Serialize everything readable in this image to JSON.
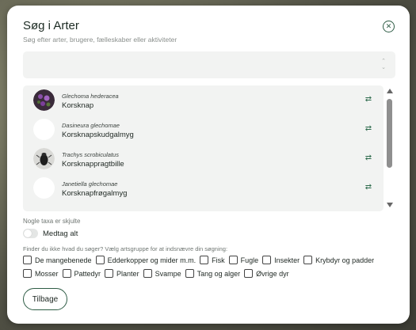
{
  "dialog": {
    "title": "Søg i Arter",
    "subtitle": "Søg efter arter, brugere, fælleskaber eller aktiviteter"
  },
  "search": {
    "value": "",
    "placeholder": ""
  },
  "results": [
    {
      "latin": "Glechoma hederacea",
      "common": "Korsknap",
      "avatar": "plant-photo"
    },
    {
      "latin": "Dasineura glechomae",
      "common": "Korsknapskudgalmyg",
      "avatar": "placeholder"
    },
    {
      "latin": "Trachys scrobiculatus",
      "common": "Korsknappragtbille",
      "avatar": "beetle-photo"
    },
    {
      "latin": "Janetiella glechomae",
      "common": "Korsknapfrøgalmyg",
      "avatar": "placeholder"
    }
  ],
  "hidden_note": "Nogle taxa er skjulte",
  "toggle": {
    "label": "Medtag alt",
    "on": false
  },
  "hint": "Finder du ikke hvad du søger? Vælg artsgruppe for at indsnævre din søgning:",
  "categories_row1": [
    "De mangebenede",
    "Edderkopper og mider m.m.",
    "Fisk",
    "Fugle",
    "Insekter",
    "Krybdyr og padder"
  ],
  "categories_row2": [
    "Mosser",
    "Pattedyr",
    "Planter",
    "Svampe",
    "Tang og alger",
    "Øvrige dyr"
  ],
  "back_button": "Tilbage",
  "colors": {
    "accent": "#2e5c45",
    "panel": "#f2f3f2"
  }
}
